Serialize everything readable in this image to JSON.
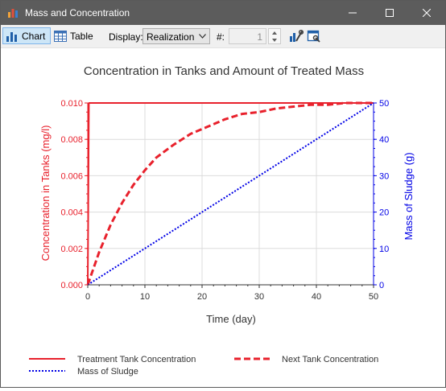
{
  "window": {
    "title": "Mass and Concentration"
  },
  "toolbar": {
    "chart_label": "Chart",
    "table_label": "Table",
    "display_label": "Display:",
    "display_value": "Realization",
    "number_label": "#:",
    "number_value": "1"
  },
  "chart_data": {
    "type": "line",
    "title": "Concentration in Tanks and Amount of Treated Mass",
    "xlabel": "Time (day)",
    "ylabel_left": "Concentration in Tanks (mg/l)",
    "ylabel_right": "Mass of Sludge (g)",
    "xlim": [
      0,
      50
    ],
    "ylim_left": [
      0,
      0.01
    ],
    "ylim_right": [
      0,
      50
    ],
    "x_ticks": [
      "0",
      "10",
      "20",
      "30",
      "40",
      "50"
    ],
    "y_left_ticks": [
      "0.000",
      "0.002",
      "0.004",
      "0.006",
      "0.008",
      "0.010"
    ],
    "y_right_ticks": [
      "0",
      "10",
      "20",
      "30",
      "40",
      "50"
    ],
    "grid": true,
    "legend_position": "bottom",
    "series": [
      {
        "name": "Treatment Tank Concentration",
        "axis": "left",
        "color": "#e8212c",
        "style": "solid",
        "x": [
          0,
          0.2,
          50
        ],
        "values": [
          0,
          0.01,
          0.01
        ]
      },
      {
        "name": "Next Tank Concentration",
        "axis": "left",
        "color": "#e8212c",
        "style": "dashed",
        "x": [
          0,
          2,
          4,
          6,
          8,
          10,
          12,
          15,
          18,
          21,
          24,
          27,
          30,
          33,
          36,
          39,
          42,
          45,
          48,
          50
        ],
        "values": [
          0,
          0.0018,
          0.0033,
          0.0045,
          0.0055,
          0.0063,
          0.007,
          0.0077,
          0.0083,
          0.0087,
          0.0091,
          0.0094,
          0.0095,
          0.0097,
          0.0098,
          0.0099,
          0.0099,
          0.01,
          0.01,
          0.01
        ]
      },
      {
        "name": "Mass of Sludge",
        "axis": "right",
        "color": "#0000e6",
        "style": "dotted",
        "x": [
          0,
          50
        ],
        "values": [
          0,
          50
        ]
      }
    ]
  }
}
